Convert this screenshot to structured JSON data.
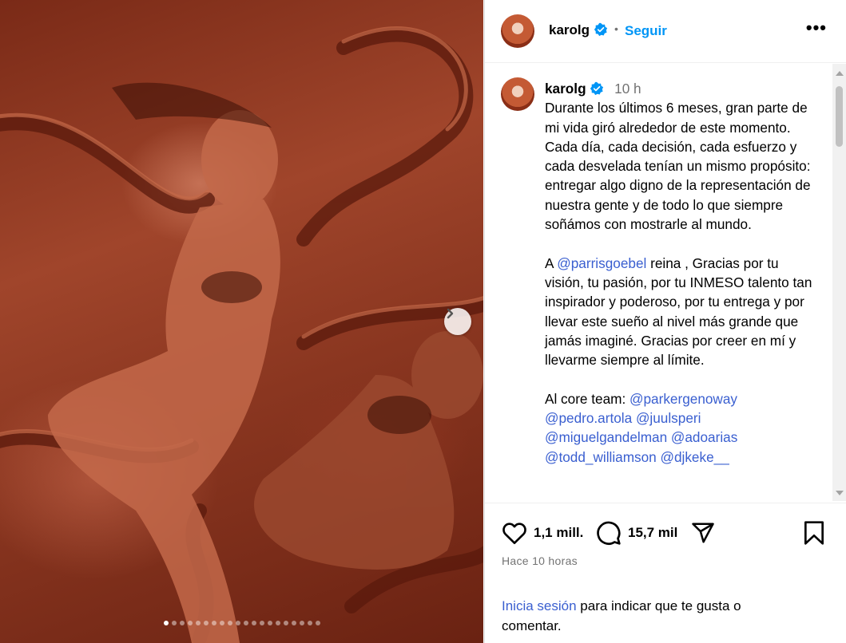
{
  "post": {
    "username": "karolg",
    "follow_label": "Seguir",
    "bullet": "•",
    "more_label": "•••",
    "time": "10 h",
    "caption_paragraphs": [
      [
        "Durante los últimos 6 meses, gran parte de mi vida giró alrededor de este momento. Cada día, cada decisión, cada esfuerzo y cada desvelada tenían un mismo propósito: entregar algo digno de la representación de nuestra gente y de todo lo que siempre soñámos con mostrarle al mundo."
      ],
      [
        "A ",
        "@parrisgoebel",
        " reina , Gracias por tu visión, tu pasión, por tu INMESO talento tan inspirador y poderoso, por tu entrega y por llevar este sueño al nivel más grande que jamás imaginé. Gracias por creer en mí y llevarme siempre al límite."
      ],
      [
        "Al core team: ",
        "@parkergenoway",
        " ",
        "@pedro.artola",
        " ",
        "@juulsperi",
        " ",
        "@miguelgandelman",
        " ",
        "@adoarias",
        " ",
        "@todd_williamson",
        " ",
        "@djkeke__"
      ]
    ],
    "likes": "1,1 mill.",
    "comments": "15,7 mil",
    "time_ago": "Hace 10 horas",
    "login_link": "Inicia sesión",
    "login_rest": " para indicar que te gusta o comentar."
  },
  "carousel": {
    "slides": 20,
    "active": 0
  },
  "colors": {
    "accent": "#0095f6",
    "mention": "#3a5fd0",
    "muted": "#737373",
    "verified": "#0095f6"
  },
  "icons": {
    "like": "heart-icon",
    "comment": "comment-icon",
    "share": "send-icon",
    "save": "bookmark-icon",
    "next": "chevron-right-icon",
    "more": "more-icon",
    "verified": "verified-badge-icon"
  }
}
